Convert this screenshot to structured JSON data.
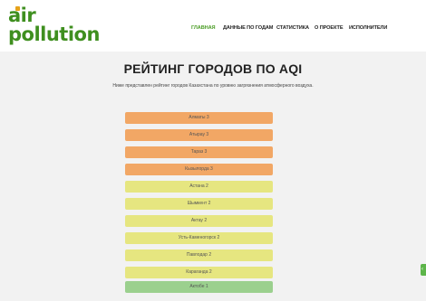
{
  "logo": {
    "line1": "air",
    "line2": "pollution"
  },
  "nav": {
    "items": [
      {
        "label": "ГЛАВНАЯ"
      },
      {
        "label": "ДАННЫЕ ПО ГОДАМ"
      },
      {
        "label": "СТАТИСТИКА"
      },
      {
        "label": "О ПРОЕКТЕ"
      },
      {
        "label": "ИСПОЛНИТЕЛИ"
      }
    ]
  },
  "page": {
    "title": "РЕЙТИНГ ГОРОДОВ ПО AQI",
    "subtitle": "Ниже представлен рейтинг городов Казахстана по уровню загрязнения атмосферного воздуха."
  },
  "ranking": [
    {
      "label": "Алматы 3",
      "level": "orange"
    },
    {
      "label": "Атырау 3",
      "level": "orange"
    },
    {
      "label": "Тараз 3",
      "level": "orange"
    },
    {
      "label": "Кызылорда 3",
      "level": "orange"
    },
    {
      "label": "Астана 2",
      "level": "yellow"
    },
    {
      "label": "Шымкент 2",
      "level": "yellow"
    },
    {
      "label": "Актау 2",
      "level": "yellow"
    },
    {
      "label": "Усть-Каменогорск 2",
      "level": "yellow"
    },
    {
      "label": "Павлодар 2",
      "level": "yellow"
    },
    {
      "label": "Караганда 2",
      "level": "yellow"
    },
    {
      "label": "Актобе 1",
      "level": "green"
    }
  ],
  "colors": {
    "brand_green": "#3f8f1f",
    "nav_active": "#4a9c24",
    "level3": "#f2a765",
    "level2": "#e6e680",
    "level1": "#9bd08e"
  },
  "side_tab": {
    "icon": "chevron-left-icon",
    "glyph": "‹"
  }
}
